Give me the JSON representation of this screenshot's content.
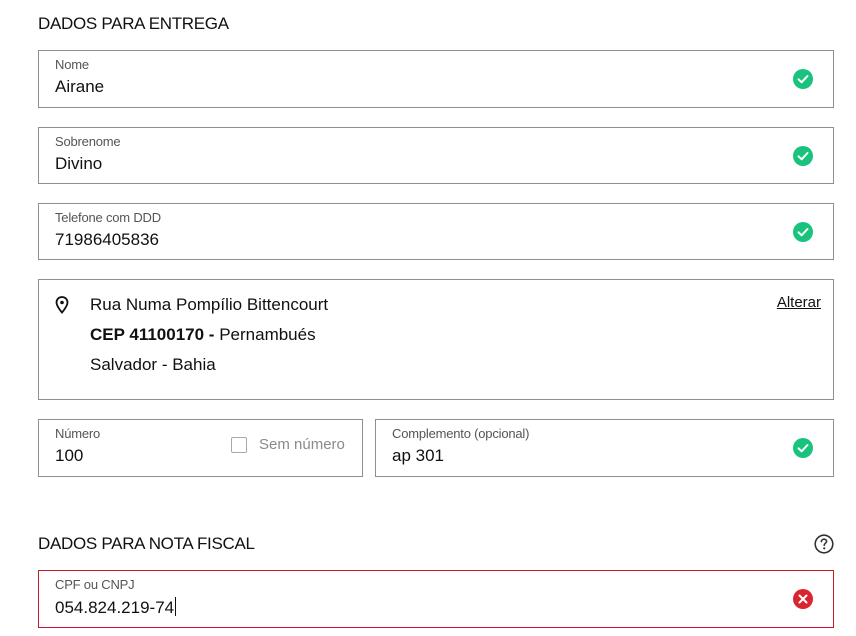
{
  "delivery": {
    "title": "DADOS PARA ENTREGA",
    "name": {
      "label": "Nome",
      "value": "Airane",
      "status": "check-icon"
    },
    "surname": {
      "label": "Sobrenome",
      "value": "Divino",
      "status": "check-icon"
    },
    "phone": {
      "label": "Telefone com DDD",
      "value": "71986405836",
      "status": "check-icon"
    },
    "address": {
      "street": "Rua Numa Pompílio Bittencourt",
      "cep_prefix": "CEP 41100170 -",
      "district": "Pernambués",
      "city_state": "Salvador - Bahia",
      "change_link": "Alterar"
    },
    "number": {
      "label": "Número",
      "value": "100",
      "no_number_label": "Sem número",
      "no_number_checked": false
    },
    "complement": {
      "label": "Complemento (opcional)",
      "value": "ap 301",
      "status": "check-icon"
    }
  },
  "invoice": {
    "title": "DADOS PARA NOTA FISCAL",
    "cpf": {
      "label": "CPF ou CNPJ",
      "value": "054.824.219-74",
      "status": "error-icon"
    }
  },
  "colors": {
    "success": "#19c37d",
    "error": "#d9252f",
    "border": "#8f8f8f",
    "error_border": "#c41a23"
  }
}
